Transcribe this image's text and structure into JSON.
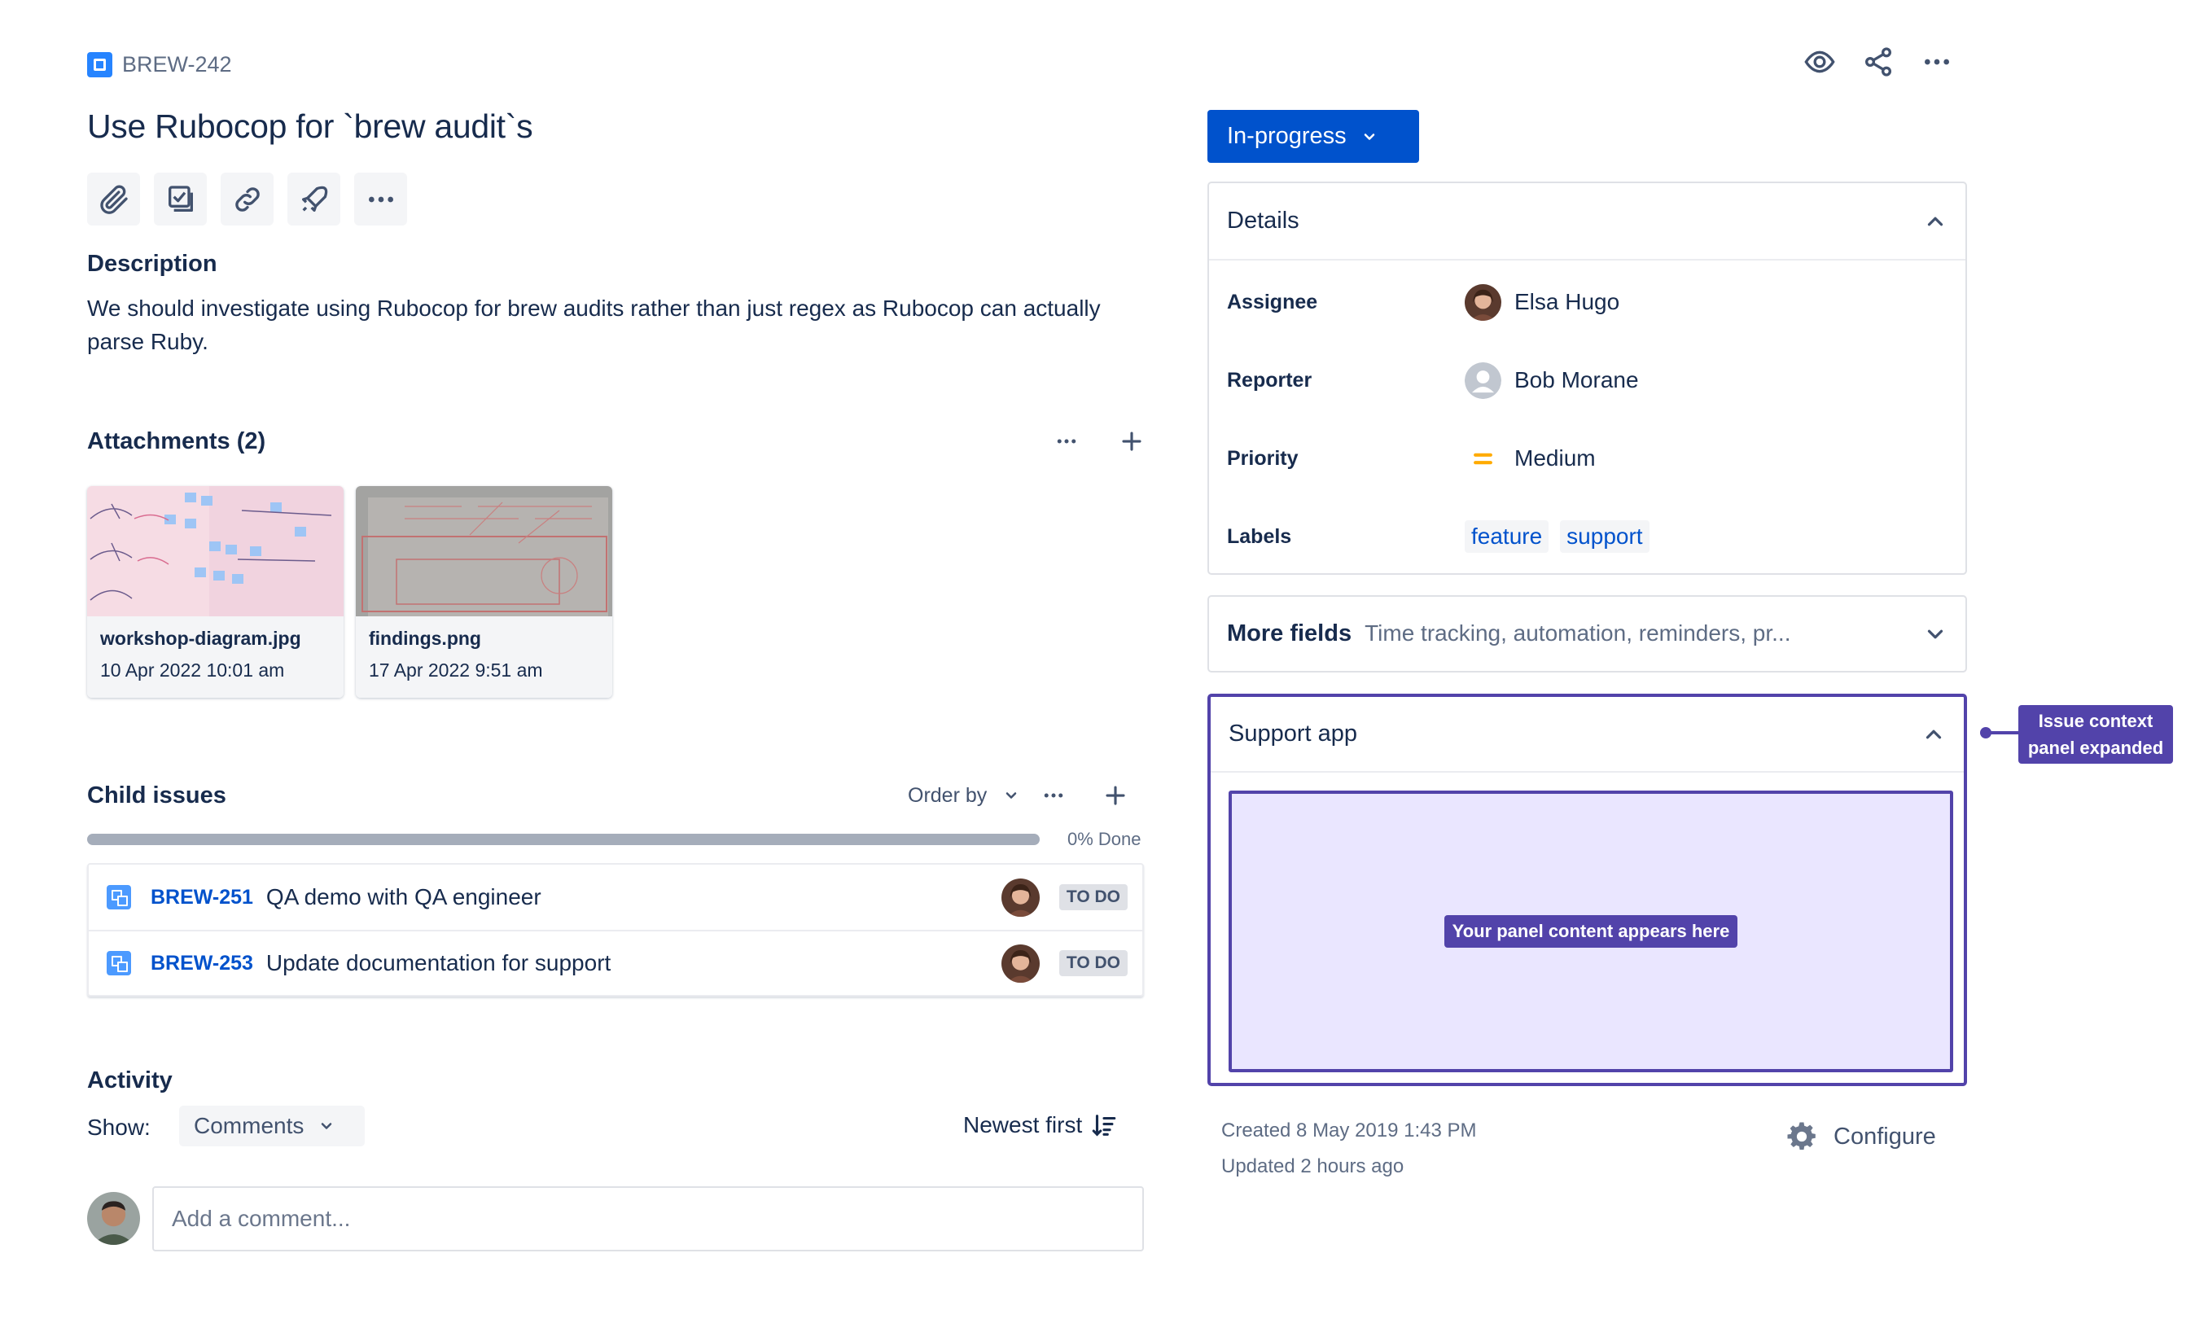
{
  "issue": {
    "key": "BREW-242",
    "title": "Use Rubocop for `brew audit`s"
  },
  "toolbar": {
    "icons": [
      "attachment-icon",
      "checklist-icon",
      "link-icon",
      "rocket-icon",
      "more-icon"
    ]
  },
  "description": {
    "heading": "Description",
    "text": "We should investigate using Rubocop for brew audits rather than just regex as Rubocop can actually parse Ruby."
  },
  "attachments": {
    "heading": "Attachments (2)",
    "items": [
      {
        "filename": "workshop-diagram.jpg",
        "date": "10 Apr 2022 10:01 am"
      },
      {
        "filename": "findings.png",
        "date": "17 Apr 2022 9:51 am"
      }
    ]
  },
  "child_issues": {
    "heading": "Child issues",
    "order_by": "Order by",
    "progress_percent": 0,
    "progress_label": "0% Done",
    "items": [
      {
        "key": "BREW-251",
        "summary": "QA demo with QA engineer",
        "status": "TO DO"
      },
      {
        "key": "BREW-253",
        "summary": "Update documentation for support",
        "status": "TO DO"
      }
    ]
  },
  "activity": {
    "heading": "Activity",
    "show_label": "Show:",
    "filter": "Comments",
    "sort": "Newest first",
    "comment_placeholder": "Add a comment..."
  },
  "status": {
    "label": "In-progress",
    "color": "#0052CC"
  },
  "details": {
    "heading": "Details",
    "assignee_label": "Assignee",
    "assignee": "Elsa Hugo",
    "reporter_label": "Reporter",
    "reporter": "Bob Morane",
    "priority_label": "Priority",
    "priority": "Medium",
    "labels_label": "Labels",
    "labels": [
      "feature",
      "support"
    ]
  },
  "more_fields": {
    "heading": "More fields",
    "subtitle": "Time tracking, automation, reminders, pr..."
  },
  "support_app": {
    "heading": "Support app",
    "placeholder": "Your panel content appears here",
    "accent": "#5243AA"
  },
  "annotation": {
    "line1": "Issue context",
    "line2": "panel expanded"
  },
  "meta": {
    "created": "Created 8 May 2019 1:43 PM",
    "updated": "Updated 2 hours ago",
    "configure": "Configure"
  }
}
